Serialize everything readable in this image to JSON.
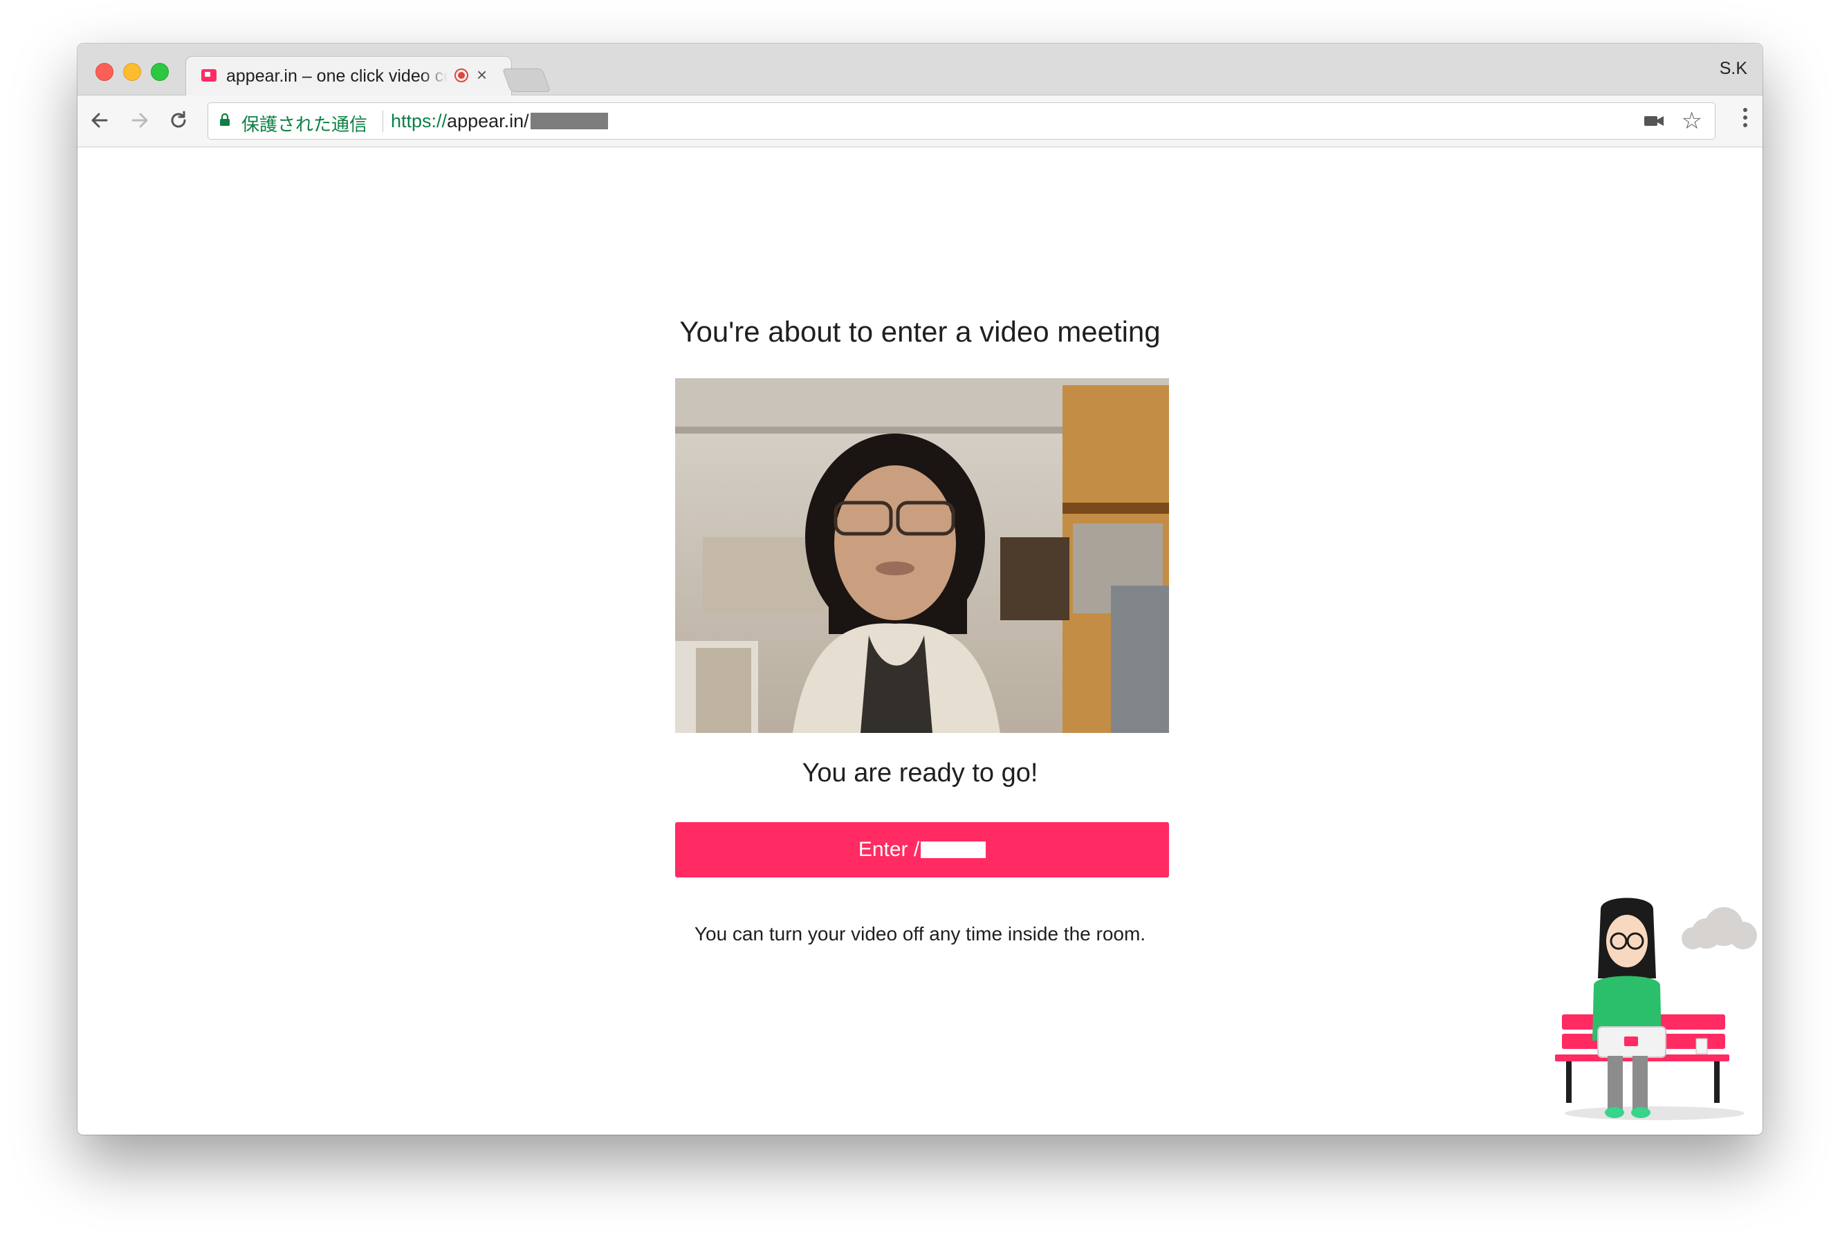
{
  "window": {
    "tab_title": "appear.in – one click video conversations",
    "profile_name": "S.K"
  },
  "toolbar": {
    "secure_label": "保護された通信",
    "url_scheme": "https://",
    "url_host": "appear.in/"
  },
  "page": {
    "heading": "You're about to enter a video meeting",
    "status": "You are ready to go!",
    "enter_label": "Enter /",
    "note": "You can turn your video off any time inside the room."
  },
  "colors": {
    "accent": "#ff2b62",
    "secure_green": "#0b8043"
  },
  "icons": [
    "back-icon",
    "forward-icon",
    "reload-icon",
    "lock-icon",
    "camera-icon",
    "star-icon",
    "menu-icon",
    "recording-icon",
    "close-icon"
  ]
}
